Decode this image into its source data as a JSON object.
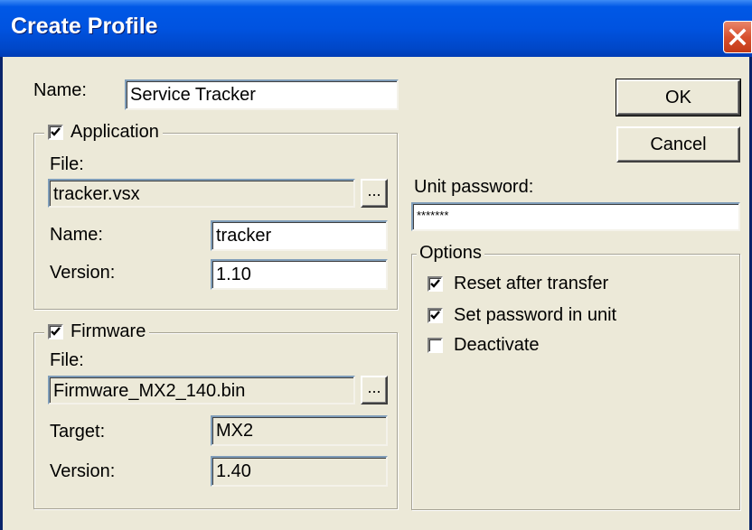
{
  "window": {
    "title": "Create Profile"
  },
  "profile": {
    "name_label": "Name:",
    "name_value": "Service Tracker"
  },
  "buttons": {
    "ok": "OK",
    "cancel": "Cancel",
    "browse": "..."
  },
  "application": {
    "legend": "Application",
    "checked": true,
    "file_label": "File:",
    "file_value": "tracker.vsx",
    "name_label": "Name:",
    "name_value": "tracker",
    "version_label": "Version:",
    "version_value": "1.10"
  },
  "firmware": {
    "legend": "Firmware",
    "checked": true,
    "file_label": "File:",
    "file_value": "Firmware_MX2_140.bin",
    "target_label": "Target:",
    "target_value": "MX2",
    "version_label": "Version:",
    "version_value": "1.40"
  },
  "unit_password": {
    "label": "Unit password:",
    "value": "*******"
  },
  "options": {
    "legend": "Options",
    "items": [
      {
        "label": "Reset after transfer",
        "checked": true
      },
      {
        "label": "Set password in unit",
        "checked": true
      },
      {
        "label": "Deactivate",
        "checked": false
      }
    ]
  },
  "icons": {
    "close": "close-icon",
    "checkmark": "checkmark-icon"
  },
  "colors": {
    "titlebar": "#0053e0",
    "dialog_bg": "#ece9d8",
    "close_button": "#d8502e"
  }
}
